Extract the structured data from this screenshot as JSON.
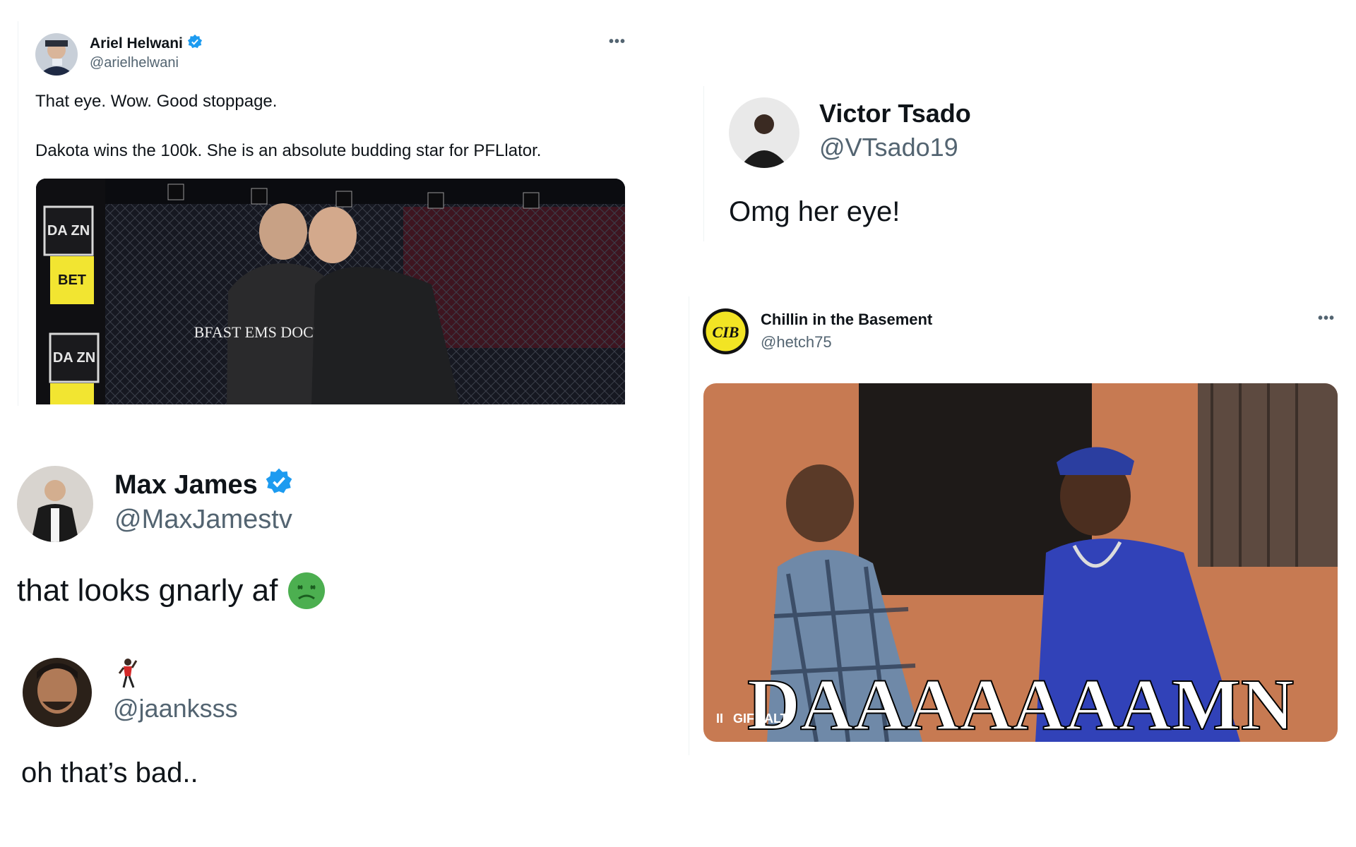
{
  "tweets": [
    {
      "name": "Ariel Helwani",
      "handle": "@arielhelwani",
      "text_line1": "That eye. Wow. Good stoppage.",
      "text_line2": "Dakota wins the 100k. She is an absolute budding star for PFLlator.",
      "media_labels": [
        "DA ZN",
        "BET",
        "DA ZN",
        "BFAST EMS DOCTOR"
      ],
      "verified": true
    },
    {
      "name": "Victor Tsado",
      "handle": "@VTsado19",
      "text": "Omg her eye!"
    },
    {
      "name": "Chillin in the Basement",
      "handle": "@hetch75",
      "avatar_text": "CIB",
      "gif_caption": "DAAAAAAAMN",
      "gif_controls": [
        "II",
        "GIF",
        "ALT"
      ]
    },
    {
      "name": "Max James",
      "handle": "@MaxJamestv",
      "text": "that looks gnarly af",
      "verified": true
    },
    {
      "name_emoji": "🕺",
      "handle": "@jaanksss",
      "text": "oh that’s bad.."
    }
  ],
  "icons": {
    "more": "more-horizontal-icon",
    "verified": "verified-badge-icon",
    "nauseated": "nauseated-face-icon"
  },
  "colors": {
    "verified_blue": "#1d9bf0",
    "secondary_text": "#536471",
    "primary_text": "#0f1419"
  }
}
